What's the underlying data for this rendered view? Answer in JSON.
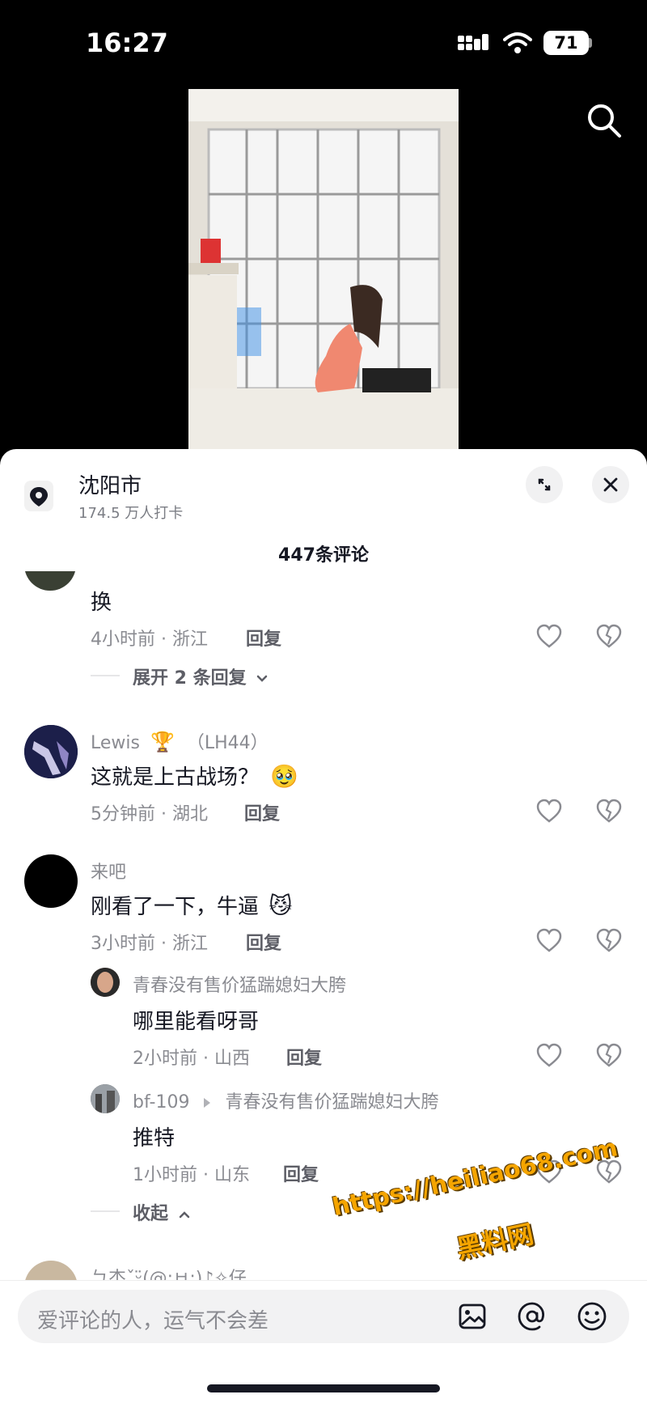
{
  "status_bar": {
    "time": "16:27",
    "battery": "71"
  },
  "location": {
    "name": "沈阳市",
    "checkins": "174.5 万人打卡"
  },
  "comments_count": "447条评论",
  "comments": [
    {
      "text": "换",
      "meta": "4小时前 · 浙江",
      "reply": "回复",
      "expand": "展开 2 条回复"
    },
    {
      "username": "Lewis",
      "badge": "🏆",
      "username_suffix": "（LH44）",
      "text": "这就是上古战场？",
      "emoji": "🥹",
      "meta": "5分钟前 · 湖北",
      "reply": "回复"
    },
    {
      "username": "来吧",
      "text": "刚看了一下，牛逼",
      "emoji": "😼",
      "meta": "3小时前 · 浙江",
      "reply": "回复"
    }
  ],
  "replies": [
    {
      "username": "青春没有售价猛踹媳妇大胯",
      "text": "哪里能看呀哥",
      "meta": "2小时前 · 山西",
      "reply": "回复"
    },
    {
      "username": "bf-109",
      "reply_to": "青春没有售价猛踹媳妇大胯",
      "text": "推特",
      "meta": "1小时前 · 山东",
      "reply": "回复"
    }
  ],
  "collapse": "收起",
  "partial_username": "ㄅ杰ˇᵕ̈(@;ㅂ;)♪✧仔",
  "watermark": {
    "url": "https://heiliao68.com",
    "name": "黑料网"
  },
  "input": {
    "placeholder": "爱评论的人，运气不会差"
  },
  "colors": {
    "accent": "#161823",
    "muted": "#8a8b91",
    "watermark": "#f5a500"
  }
}
